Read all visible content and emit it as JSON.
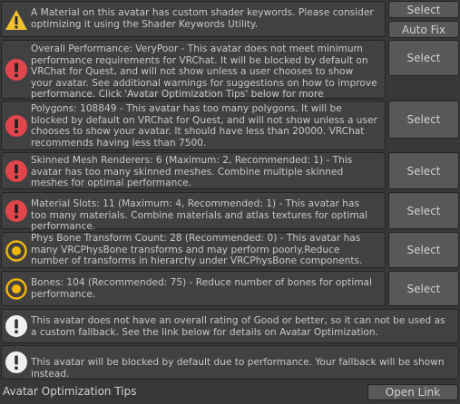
{
  "colors": {
    "background": "#383838",
    "box": "#414141",
    "button": "#585858",
    "error_red": "#e0464b",
    "warning_yellow": "#f2c12e",
    "info_yellow_ring": "#f2b70c",
    "text": "#c8c8c8"
  },
  "messages": [
    {
      "icon": "warning-triangle-icon",
      "text": "A Material on this avatar has custom shader keywords. Please consider optimizing it using the Shader Keywords Utility."
    },
    {
      "icon": "error-icon",
      "text": "Overall Performance: VeryPoor - This avatar does not meet minimum performance requirements for VRChat. It will be blocked by default on VRChat for Quest, and will not show unless a user chooses to show your avatar. See additional warnings for suggestions on how to improve performance. Click 'Avatar Optimization Tips' below for more information."
    },
    {
      "icon": "error-icon",
      "text": "Polygons: 108849 - This avatar has too many polygons. It will be blocked by default on VRChat for Quest, and will not show unless a user chooses to show your avatar. It should have less than 20000. VRChat recommends having less than 7500."
    },
    {
      "icon": "error-icon",
      "text": "Skinned Mesh Renderers: 6 (Maximum: 2, Recommended: 1) - This avatar has too many skinned meshes. Combine multiple skinned meshes for optimal performance."
    },
    {
      "icon": "error-icon",
      "text": "Material Slots: 11 (Maximum: 4, Recommended: 1) - This avatar has too many materials. Combine materials and atlas textures for optimal performance."
    },
    {
      "icon": "circle-info-icon",
      "text": "Phys Bone Transform Count: 28 (Recommended: 0) - This avatar has many VRCPhysBone transforms and may perform poorly.Reduce number of transforms in hierarchy under VRCPhysBone components."
    },
    {
      "icon": "circle-info-icon",
      "text": "Bones: 104 (Recommended: 75) - Reduce number of bones for optimal performance."
    },
    {
      "icon": "info-icon",
      "text": "This avatar does not have an overall rating of Good or better, so it can not be used as a custom fallback. See the link below for details on Avatar Optimization."
    },
    {
      "icon": "info-icon",
      "text": "This avatar will be blocked by default due to performance. Your fallback will be shown instead."
    }
  ],
  "buttons": {
    "select": "Select",
    "auto_fix": "Auto Fix",
    "open_link": "Open Link"
  },
  "footer": {
    "label": "Avatar Optimization Tips"
  }
}
